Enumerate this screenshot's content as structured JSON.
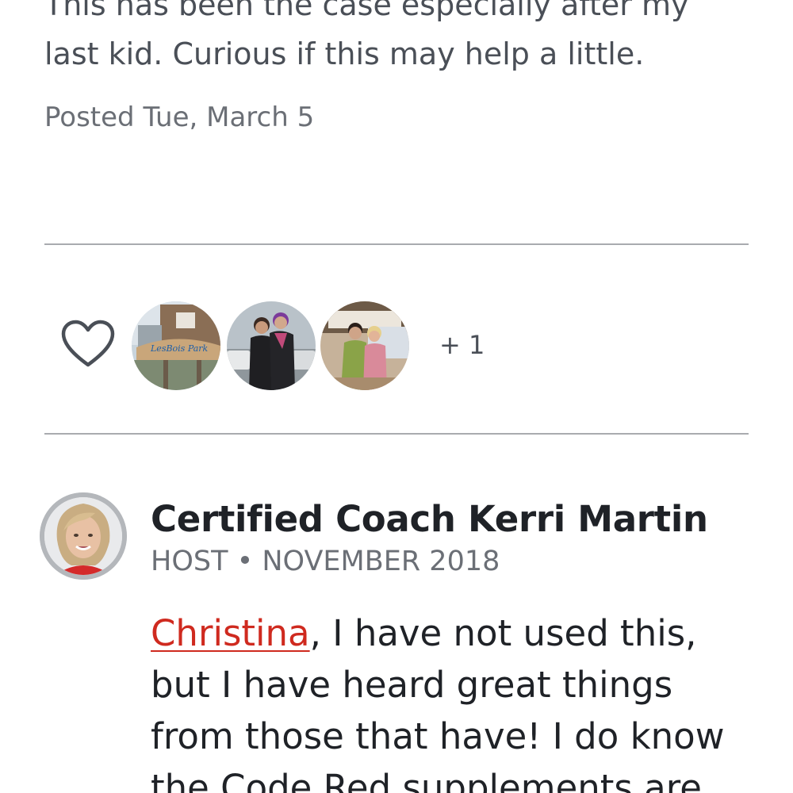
{
  "post": {
    "line1": "This has been the case especially after my",
    "line2": "last kid. Curious if this may help a little.",
    "posted": "Posted Tue, March 5"
  },
  "reactions": {
    "more_count": "+ 1",
    "avatar1_sign": "LesBois Park"
  },
  "comment": {
    "author": "Certified Coach Kerri Martin",
    "meta": "HOST • NOVEMBER 2018",
    "mention": "Christina",
    "line1_rest": ", I have not used this,",
    "line2": "but I have heard great things",
    "line3": "from those that have! I do know",
    "line4": "the Code Red supplements are"
  },
  "colors": {
    "mention": "#cf2a1f",
    "divider": "#a9abaf",
    "text_dark": "#1f2227",
    "text_muted": "#6b6f76"
  }
}
